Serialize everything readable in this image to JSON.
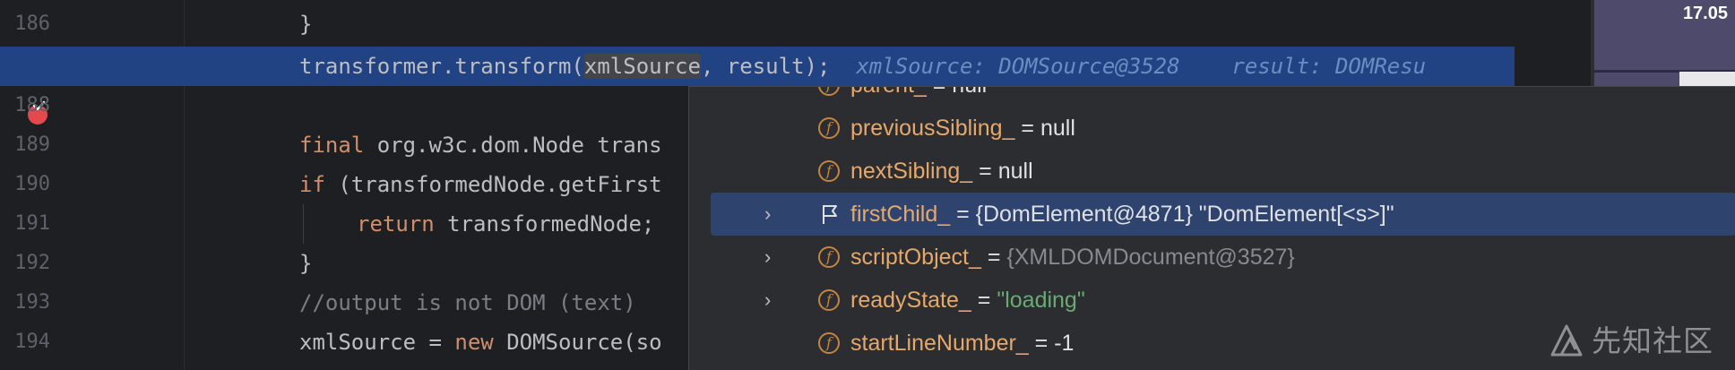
{
  "editor": {
    "lines": [
      {
        "num": "186",
        "code": "}"
      },
      {
        "num": "",
        "code_a": "transformer.transform(",
        "code_sel": "xmlSource",
        "code_b": ", result);",
        "inlay1": "xmlSource: DOMSource@3528",
        "inlay2": "result: DOMResu"
      },
      {
        "num": "188",
        "code": ""
      },
      {
        "num": "189",
        "kw": "final",
        "code": " org.w3c.dom.Node trans"
      },
      {
        "num": "190",
        "kw": "if",
        "code": " (transformedNode.getFirst"
      },
      {
        "num": "191",
        "kw": "return",
        "code": " transformedNode;"
      },
      {
        "num": "192",
        "code": "}"
      },
      {
        "num": "193",
        "comment": "//output is not DOM (text)"
      },
      {
        "num": "194",
        "code_a": "xmlSource = ",
        "kw": "new",
        "code_b": " DOMSource(so"
      }
    ],
    "breakpoint_icon": "breakpoint-checked-icon"
  },
  "thumbnail": {
    "time": "17.05"
  },
  "debug_popup": {
    "rows": [
      {
        "name": "parent_",
        "eq": " = ",
        "value": "null",
        "style": "plain",
        "expandable": false,
        "icon": "field-icon"
      },
      {
        "name": "previousSibling_",
        "eq": " = ",
        "value": "null",
        "style": "plain",
        "expandable": false,
        "icon": "field-icon"
      },
      {
        "name": "nextSibling_",
        "eq": " = ",
        "value": "null",
        "style": "plain",
        "expandable": false,
        "icon": "field-icon"
      },
      {
        "name": "firstChild_",
        "eq": " = ",
        "value": "{DomElement@4871} \"DomElement[<s>]\"",
        "style": "plain",
        "expandable": true,
        "icon": "flag-icon",
        "selected": true
      },
      {
        "name": "scriptObject_",
        "eq": " = ",
        "value": "{XMLDOMDocument@3527}",
        "style": "grey",
        "expandable": true,
        "icon": "field-icon"
      },
      {
        "name": "readyState_",
        "eq": " = ",
        "value": "\"loading\"",
        "style": "string",
        "expandable": true,
        "icon": "field-icon"
      },
      {
        "name": "startLineNumber_",
        "eq": " = ",
        "value": "-1",
        "style": "plain",
        "expandable": false,
        "icon": "field-icon"
      }
    ],
    "field_icon_letter": "f"
  },
  "watermark": {
    "text": "先知社区"
  }
}
